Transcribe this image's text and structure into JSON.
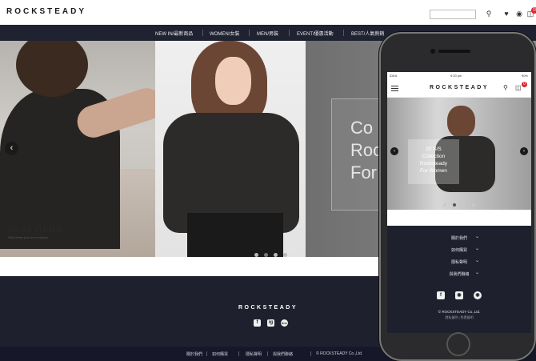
{
  "header": {
    "logo": "ROCKSTEADY",
    "search_placeholder": "",
    "cart_count": "0"
  },
  "nav": {
    "items": [
      "NEW IN/最新商品",
      "WOMEN/女裝",
      "MEN/男裝",
      "EVENT/優惠活動",
      "BEST/人氣熱銷"
    ]
  },
  "hero": {
    "silky_title": "SILKY ITEMS",
    "silky_sub": "Silky items just for everyday",
    "right_text": [
      "Co",
      "Roc",
      "For"
    ],
    "prev_label": "‹"
  },
  "footer": {
    "logo": "ROCKSTEADY",
    "social": [
      "f",
      "ig",
      "line"
    ],
    "links": [
      "關於我們",
      "如何購買",
      "隱私聲明",
      "與我們聯絡"
    ],
    "copyright": "© ROCKSTEADY Co.,Ltd."
  },
  "phone": {
    "status_carrier": "IDEA",
    "status_time": "9:20 pm",
    "status_battery": "90%",
    "logo": "ROCKSTEADY",
    "cart_count": "0",
    "hero_text": [
      "20 S/S",
      "Collection",
      "Rocksteady",
      "For Women"
    ],
    "footer_links": [
      "關於我們",
      "如何購買",
      "隱私聲明",
      "與我們聯絡"
    ],
    "copyright": "© ROCKSTEADY Co.,Ltd.",
    "copyright_sub": "隱私聲明 | 免責聲明"
  }
}
